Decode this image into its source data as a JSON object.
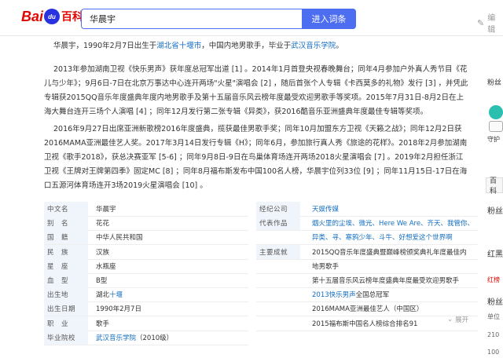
{
  "header": {
    "logo_bai": "Bai",
    "logo_du": "du",
    "logo_baike": "百科",
    "search_value": "华晨宇",
    "search_button": "进入词条",
    "edit_label": "编辑"
  },
  "intro": {
    "p1_a": "华晨宇，1990年2月7日出生于",
    "p1_link1": "湖北省十堰市",
    "p1_b": "，中国内地男歌手，毕业于",
    "p1_link2": "武汉音乐学院",
    "p1_c": "。",
    "p2": "2013年参加湖南卫视《快乐男声》获年度总冠军出道 [1] 。2014年1月首登央视春晚舞台；同年4月参加户外真人秀节目《花儿与少年》；9月6日-7日在北京万事达中心连开两场\"火星\"演唱会 [2] ，随后首张个人专辑《卡西莫多的礼物》发行 [3] ，并凭此专辑获2015QQ音乐年度盛典年度内地男歌手及第十五届音乐风云榜年度最受欢迎男歌手等奖项。2015年7月31日-8月2日在上海大舞台连开三场个人演唱 [4] ；同年12月发行第二张专辑《异类》，获2016酷音乐亚洲盛典年度最佳专辑等奖项。",
    "p3": "2016年9月27日出席亚洲新歌榜2016年度盛典，揽获最佳男歌手奖；同年10月加盟东方卫视《天籁之战》；同年12月2日获2016MAMA亚洲最佳艺人奖。2017年3月14日发行专辑《H》；同年6月，参加旅行真人秀《旅途的花样》。2018年2月参加湖南卫视《歌手2018》，获总决赛亚军 [5-6] ；同年9月8日-9日在鸟巢体育场连开两场2018火星演唱会 [7] 。2019年2月担任浙江卫视《王牌对王牌第四季》固定MC [8] ；同年8月福布斯发布中国100名人榜，华晨宇位列33位 [9] ；同年11月15日-17日在海口五源河体育场连开3场2019火星演唱会 [10] 。"
  },
  "infobox": {
    "left": [
      {
        "label": "中文名",
        "value": "华晨宇"
      },
      {
        "label": "别　名",
        "value": "花花"
      },
      {
        "label": "国　籍",
        "value": "中华人民共和国"
      },
      {
        "label": "民　族",
        "value": "汉族"
      },
      {
        "label": "星　座",
        "value": "水瓶座"
      },
      {
        "label": "血　型",
        "value": "B型"
      },
      {
        "label": "出生地",
        "value": "湖北",
        "link": "十堰"
      },
      {
        "label": "出生日期",
        "value": "1990年2月7日"
      },
      {
        "label": "职　业",
        "value": "歌手"
      },
      {
        "label": "毕业院校",
        "link": "武汉音乐学院",
        "value": "（2010级）"
      }
    ],
    "right": [
      {
        "label": "经纪公司",
        "link": "天娱传媒"
      },
      {
        "label": "代表作品",
        "link": "烟火里的尘埃、微光、Here We Are、齐天、我管你、"
      },
      {
        "label": "",
        "link": "异类、寻、寒鸦少年、斗牛、好想爱这个世界啊"
      },
      {
        "label": "主要成就",
        "value": "2015QQ音乐年度盛典暨巅峰榜颁奖典礼年度最佳内"
      },
      {
        "label": "",
        "value": "地男歌手"
      },
      {
        "label": "",
        "value": "第十五届音乐风云榜年度盛典年度最受欢迎男歌手"
      },
      {
        "label": "",
        "link": "2013快乐男声",
        "value": "全国总冠军"
      },
      {
        "label": "",
        "value": "2016MAMA亚洲最佳艺人（中国区）"
      },
      {
        "label": "",
        "value": "2015福布斯中国名人榜综合排名91"
      }
    ],
    "expand": "展开"
  },
  "sidebar": {
    "items": [
      "粉丝",
      "守护",
      "百科",
      "粉丝",
      "红黑",
      "粉丝",
      "单位",
      "210",
      "100"
    ]
  }
}
